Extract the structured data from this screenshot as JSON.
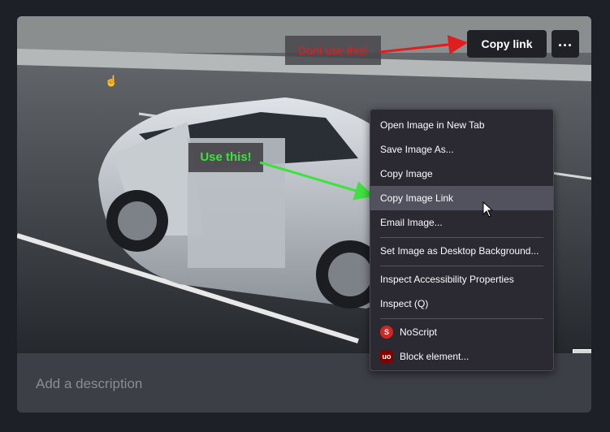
{
  "buttons": {
    "copy_link": "Copy link",
    "more": "..."
  },
  "annotations": {
    "dont_use": "Dont use this!",
    "use": "Use this!"
  },
  "caption": {
    "placeholder": "Add a description"
  },
  "context_menu": {
    "items": [
      {
        "label": "Open Image in New Tab"
      },
      {
        "label": "Save Image As..."
      },
      {
        "label": "Copy Image"
      },
      {
        "label": "Copy Image Link",
        "highlighted": true
      },
      {
        "label": "Email Image..."
      },
      {
        "label": "Set Image as Desktop Background..."
      },
      {
        "label": "Inspect Accessibility Properties"
      },
      {
        "label": "Inspect (Q)"
      },
      {
        "label": "NoScript",
        "icon": "noscript-icon"
      },
      {
        "label": "Block element...",
        "icon": "ublock-origin-icon"
      }
    ]
  },
  "colors": {
    "annotation_red": "#e01e1e",
    "annotation_green": "#3fe03f",
    "menu_bg": "#2b2a33",
    "menu_hover": "#52525e"
  }
}
